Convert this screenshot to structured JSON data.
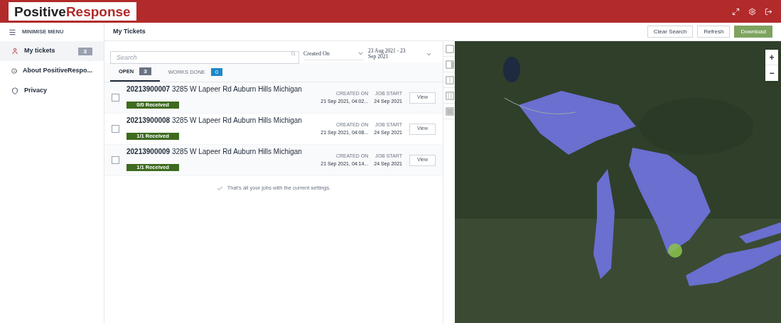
{
  "header": {
    "logo_first": "Positive",
    "logo_second": "Response"
  },
  "sidebar": {
    "minimise": "MINIMISE MENU",
    "items": [
      {
        "label": "My tickets",
        "badge": "3",
        "selected": true
      },
      {
        "label": "About PositiveRespo...",
        "selected": false
      },
      {
        "label": "Privacy",
        "selected": false
      }
    ]
  },
  "toolbar": {
    "title": "My Tickets",
    "buttons": [
      {
        "label": "Clear Search",
        "kind": "outline"
      },
      {
        "label": "Refresh",
        "kind": "outline"
      },
      {
        "label": "Download",
        "kind": "primary"
      }
    ]
  },
  "filters": {
    "search_placeholder": "Search",
    "sort": "Created On",
    "date_range": "23 Aug 2021 - 23 Sep 2021"
  },
  "tabs": [
    {
      "label": "OPEN",
      "count": "3",
      "selected": true
    },
    {
      "label": "WORKS DONE",
      "count": "0",
      "selected": false
    }
  ],
  "tickets": [
    {
      "number": "20213900007",
      "address": "3285 W Lapeer Rd Auburn Hills Michigan",
      "status": "0/0 Received",
      "created_label": "CREATED ON",
      "created": "21 Sep 2021, 04:02...",
      "start_label": "JOB START",
      "start": "24 Sep 2021",
      "action": "View",
      "checked": false
    },
    {
      "number": "20213900008",
      "address": "3285 W Lapeer Rd Auburn Hills Michigan",
      "status": "1/1 Received",
      "created_label": "CREATED ON",
      "created": "21 Sep 2021, 04:08...",
      "start_label": "JOB START",
      "start": "24 Sep 2021",
      "action": "View",
      "checked": false
    },
    {
      "number": "20213900009",
      "address": "3285 W Lapeer Rd Auburn Hills Michigan",
      "status": "1/1 Received",
      "created_label": "CREATED ON",
      "created": "21 Sep 2021, 04:14...",
      "start_label": "JOB START",
      "start": "24 Sep 2021",
      "action": "View",
      "checked": false
    }
  ],
  "end_message": "That's all your jobs with the current settings.",
  "layouts": [
    {
      "kind": "full",
      "selected": false
    },
    {
      "kind": "right",
      "selected": false
    },
    {
      "kind": "half",
      "selected": false
    },
    {
      "kind": "split",
      "selected": false
    },
    {
      "kind": "left",
      "selected": false
    }
  ],
  "map": {
    "zoom_in": "+",
    "zoom_out": "−"
  }
}
